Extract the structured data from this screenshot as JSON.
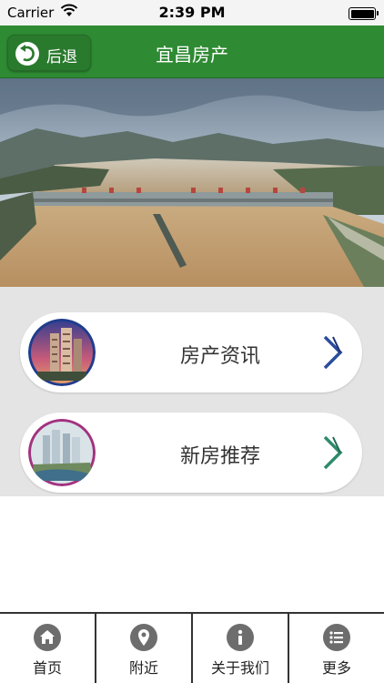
{
  "status_bar": {
    "carrier": "Carrier",
    "time": "2:39 PM",
    "battery_level": 1.0
  },
  "nav": {
    "back_label": "后退",
    "title": "宜昌房产"
  },
  "menu": [
    {
      "label": "房产资讯",
      "chevron_color": "#2b4d9c"
    },
    {
      "label": "新房推荐",
      "chevron_color": "#2f8a6a"
    }
  ],
  "tabs": [
    {
      "label": "首页",
      "icon": "home-icon"
    },
    {
      "label": "附近",
      "icon": "location-pin-icon"
    },
    {
      "label": "关于我们",
      "icon": "info-icon"
    },
    {
      "label": "更多",
      "icon": "list-icon"
    }
  ],
  "colors": {
    "nav_green": "#2e8a33",
    "content_bg": "#e4e4e4",
    "tab_icon_gray": "#6d6d6d"
  }
}
